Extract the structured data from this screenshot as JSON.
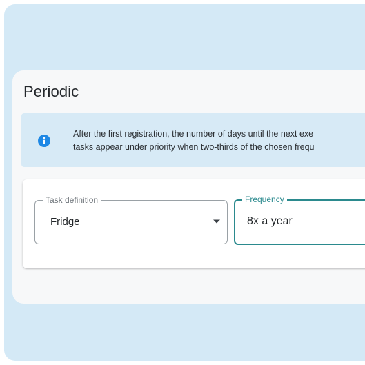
{
  "section": {
    "title": "Periodic"
  },
  "info": {
    "line1": "After the first registration, the number of days until the next exe",
    "line2": "tasks appear under priority when two-thirds of the chosen frequ",
    "icon": "info-icon",
    "icon_color": "#1e88e5"
  },
  "form": {
    "task_definition": {
      "label": "Task definition",
      "value": "Fridge"
    },
    "frequency": {
      "label": "Frequency",
      "value": "8x a year"
    }
  },
  "colors": {
    "background": "#d4e9f6",
    "panel": "#f7f8f9",
    "accent": "#2b8a8e"
  }
}
